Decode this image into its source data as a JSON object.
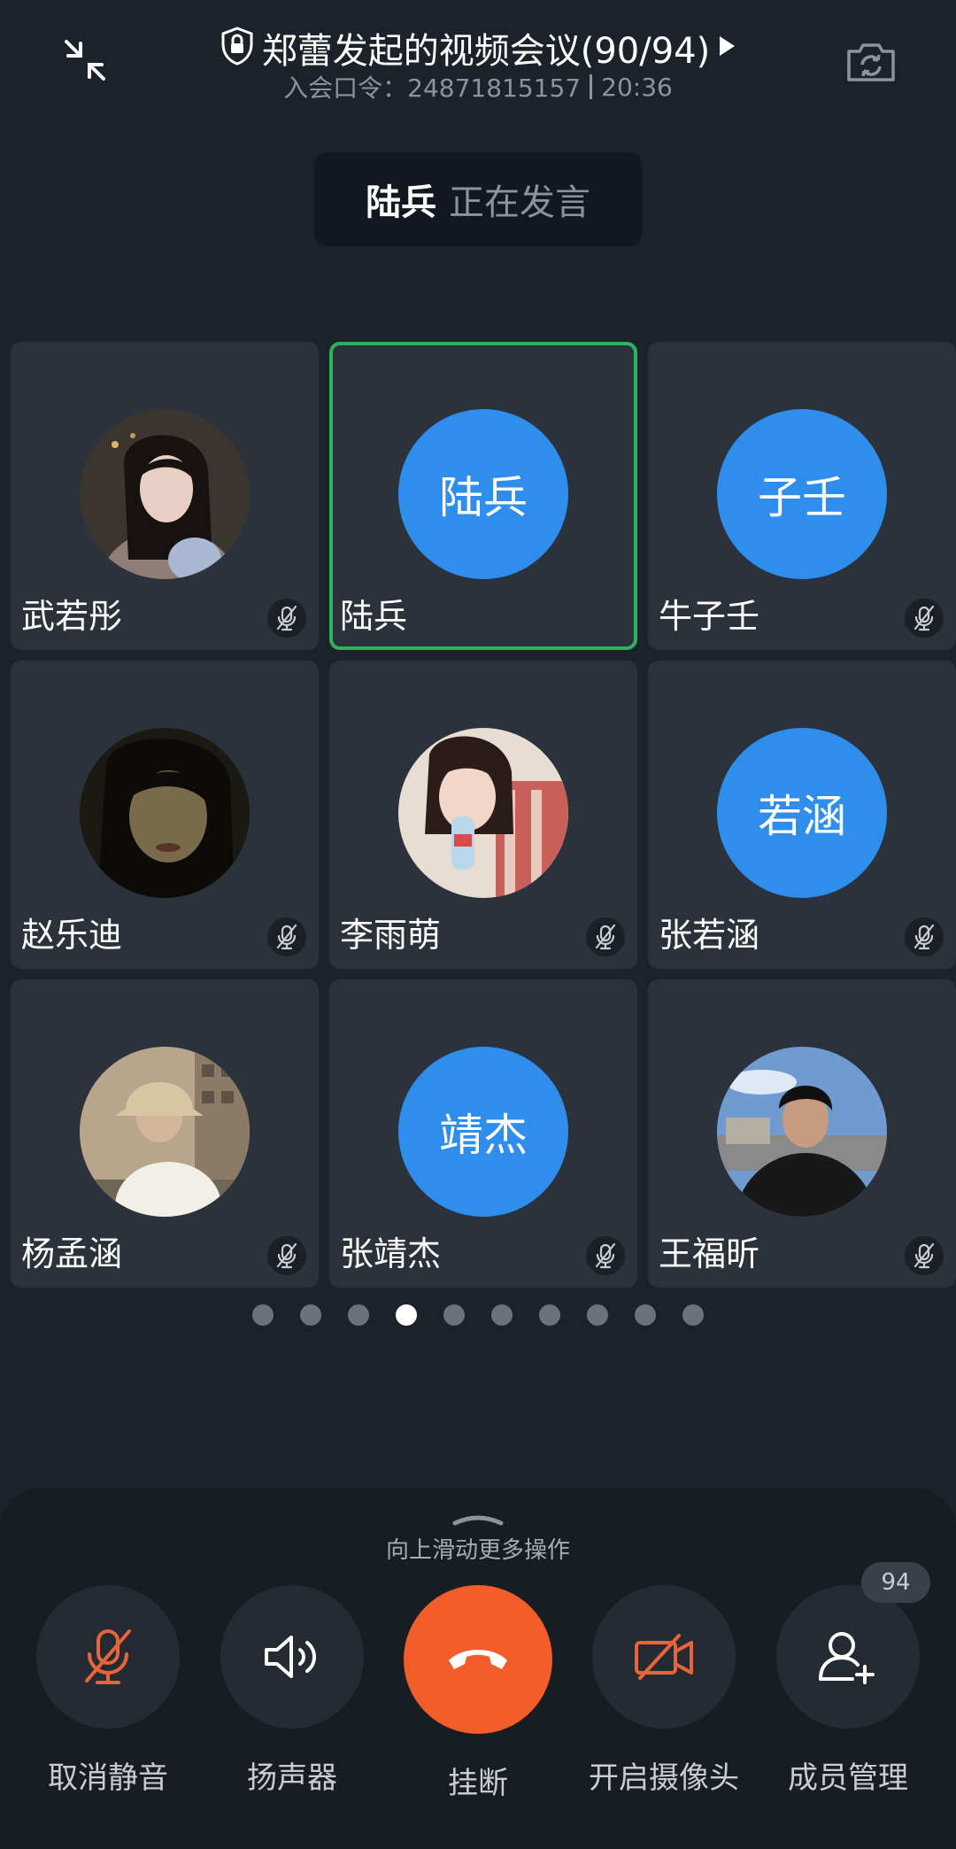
{
  "header": {
    "title": "郑蕾发起的视频会议(90/94)",
    "meeting_code_label": "入会口令：24871815157",
    "time": "20:36"
  },
  "speaking": {
    "name": "陆兵",
    "status": "正在发言"
  },
  "tiles": [
    {
      "name": "武若彤",
      "avatar_type": "photo",
      "muted": true,
      "active": false
    },
    {
      "name": "陆兵",
      "avatar_type": "initials",
      "initials": "陆兵",
      "muted": false,
      "active": true
    },
    {
      "name": "牛子壬",
      "avatar_type": "initials",
      "initials": "子壬",
      "muted": true,
      "active": false
    },
    {
      "name": "赵乐迪",
      "avatar_type": "photo",
      "muted": true,
      "active": false
    },
    {
      "name": "李雨萌",
      "avatar_type": "photo",
      "muted": true,
      "active": false
    },
    {
      "name": "张若涵",
      "avatar_type": "initials",
      "initials": "若涵",
      "muted": true,
      "active": false
    },
    {
      "name": "杨孟涵",
      "avatar_type": "photo",
      "muted": true,
      "active": false
    },
    {
      "name": "张靖杰",
      "avatar_type": "initials",
      "initials": "靖杰",
      "muted": true,
      "active": false
    },
    {
      "name": "王福昕",
      "avatar_type": "photo",
      "muted": true,
      "active": false
    }
  ],
  "pager": {
    "total_pages": 10,
    "current_page": 4
  },
  "bottom": {
    "swipe_hint": "向上滑动更多操作",
    "actions": [
      {
        "label": "取消静音",
        "icon": "mic-off-icon"
      },
      {
        "label": "扬声器",
        "icon": "speaker-icon"
      },
      {
        "label": "挂断",
        "icon": "hangup-icon"
      },
      {
        "label": "开启摄像头",
        "icon": "camera-off-icon"
      },
      {
        "label": "成员管理",
        "icon": "add-member-icon"
      }
    ],
    "member_count": "94"
  },
  "colors": {
    "background": "#1c222a",
    "tile": "#2b323b",
    "accent_green": "#2ab55a",
    "avatar_blue": "#2f8eeb",
    "hangup_orange": "#f25d2a"
  }
}
